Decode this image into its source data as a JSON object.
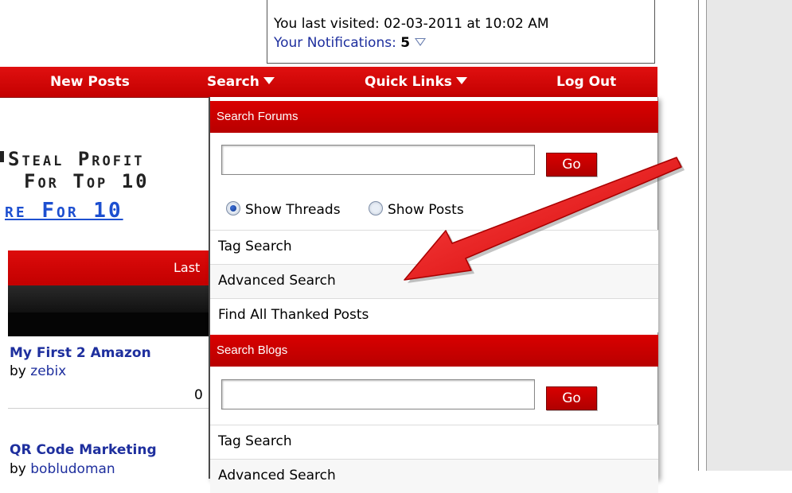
{
  "header": {
    "visited_text": "You last visited: 02-03-2011 at 10:02 AM",
    "notifications_label": "Your Notifications:",
    "notifications_count": "5"
  },
  "navbar": {
    "items": [
      {
        "label": "New Posts"
      },
      {
        "label": "Search"
      },
      {
        "label": "Quick Links"
      },
      {
        "label": "Log Out"
      }
    ]
  },
  "ad": {
    "line1": "Steal Profit",
    "line2": "For Top 10",
    "line3": "re For 10"
  },
  "thread_table": {
    "header_partial": "Last",
    "threads": [
      {
        "title": "My First 2 Amazon",
        "by_label": "by",
        "author": "zebix",
        "count": "0"
      },
      {
        "title": "QR Code Marketing",
        "by_label": "by",
        "author": "bobludoman"
      }
    ]
  },
  "search_dropdown": {
    "forums_header": "Search Forums",
    "go_label": "Go",
    "radio_threads": "Show Threads",
    "radio_posts": "Show Posts",
    "selected_radio": "Show Threads",
    "forum_links": [
      "Tag Search",
      "Advanced Search",
      "Find All Thanked Posts"
    ],
    "blogs_header": "Search Blogs",
    "blog_go_label": "Go",
    "blog_links": [
      "Tag Search",
      "Advanced Search"
    ]
  },
  "colors": {
    "accent_red": "#cc0000",
    "link_blue": "#1e2f9e",
    "arrow_red": "#e51b1b"
  }
}
